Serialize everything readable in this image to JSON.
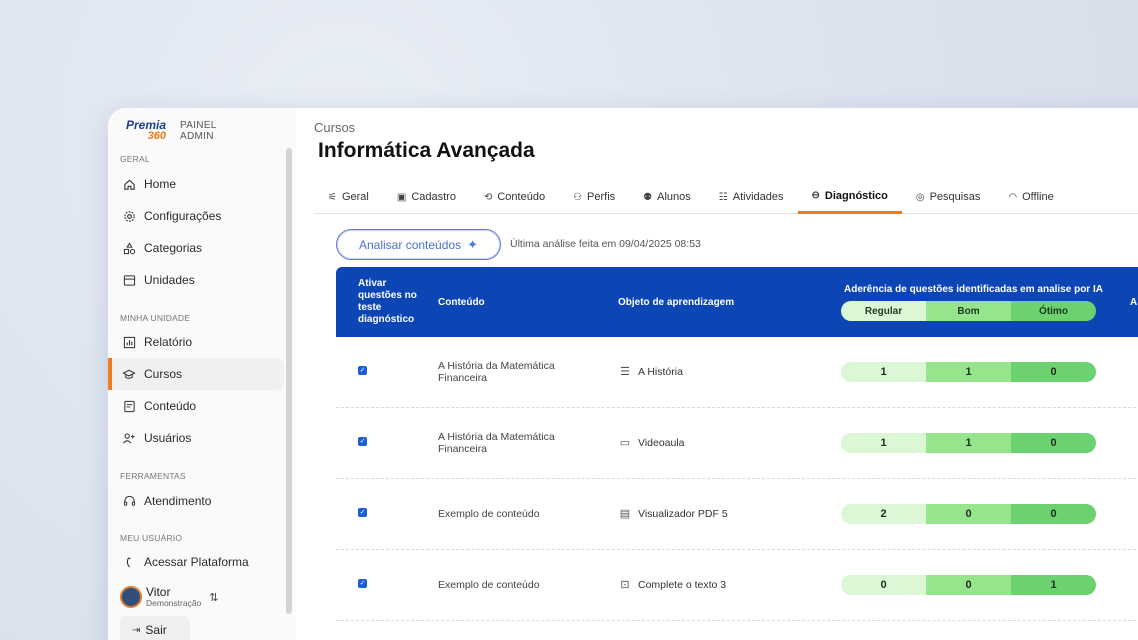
{
  "sidebar": {
    "logo": {
      "brand": "Premia",
      "number": "360",
      "panel_line1": "PAINEL",
      "panel_line2": "ADMIN"
    },
    "sections": {
      "geral": "GERAL",
      "minha_unidade": "MINHA UNIDADE",
      "ferramentas": "FERRAMENTAS",
      "meu_usuario": "MEU USUÁRIO"
    },
    "items": [
      {
        "label": "Home",
        "icon": "home-icon"
      },
      {
        "label": "Configurações",
        "icon": "gear-icon"
      },
      {
        "label": "Categorias",
        "icon": "categories-icon"
      },
      {
        "label": "Unidades",
        "icon": "store-icon"
      },
      {
        "label": "Relatório",
        "icon": "chart-icon"
      },
      {
        "label": "Cursos",
        "icon": "graduation-cap-icon"
      },
      {
        "label": "Conteúdo",
        "icon": "document-icon"
      },
      {
        "label": "Usuários",
        "icon": "user-add-icon"
      },
      {
        "label": "Atendimento",
        "icon": "headset-icon"
      },
      {
        "label": "Acessar Plataforma",
        "icon": "launch-icon"
      }
    ],
    "user": {
      "name": "Vitor",
      "role": "Demonstração"
    },
    "logout": "Sair"
  },
  "main": {
    "breadcrumb": "Cursos",
    "title": "Informática Avançada",
    "tabs": [
      {
        "label": "Geral"
      },
      {
        "label": "Cadastro"
      },
      {
        "label": "Conteúdo"
      },
      {
        "label": "Perfis"
      },
      {
        "label": "Alunos"
      },
      {
        "label": "Atividades"
      },
      {
        "label": "Diagnóstico"
      },
      {
        "label": "Pesquisas"
      },
      {
        "label": "Offline"
      }
    ],
    "active_tab": "Diagnóstico",
    "analyze_button": "Analisar conteúdos",
    "last_analysis": "Última análise feita em 09/04/2025 08:53"
  },
  "table": {
    "headers": {
      "ativar": "Ativar questões no teste diagnóstico",
      "conteudo": "Conteúdo",
      "objeto": "Objeto de aprendizagem",
      "aderencia": "Aderência de questões identificadas em analise por IA",
      "extra": "A"
    },
    "legend": {
      "regular": "Regular",
      "bom": "Bom",
      "otimo": "Ótimo"
    },
    "rows": [
      {
        "checked": true,
        "conteudo": "A História da Matemática Financeira",
        "objeto": "A História",
        "objeto_icon": "text-document-icon",
        "regular": "1",
        "bom": "1",
        "otimo": "0"
      },
      {
        "checked": true,
        "conteudo": "A História da Matemática Financeira",
        "objeto": "Videoaula",
        "objeto_icon": "video-icon",
        "regular": "1",
        "bom": "1",
        "otimo": "0"
      },
      {
        "checked": true,
        "conteudo": "Exemplo de conteúdo",
        "objeto": "Visualizador PDF 5",
        "objeto_icon": "pdf-viewer-icon",
        "regular": "2",
        "bom": "0",
        "otimo": "0"
      },
      {
        "checked": true,
        "conteudo": "Exemplo de conteúdo",
        "objeto": "Complete o texto 3",
        "objeto_icon": "fill-text-icon",
        "regular": "0",
        "bom": "0",
        "otimo": "1"
      }
    ]
  },
  "colors": {
    "accent": "#f07a1e",
    "header_blue": "#0c46b4",
    "regular": "#dcf7d6",
    "bom": "#96e48c",
    "otimo": "#6cd26f"
  }
}
